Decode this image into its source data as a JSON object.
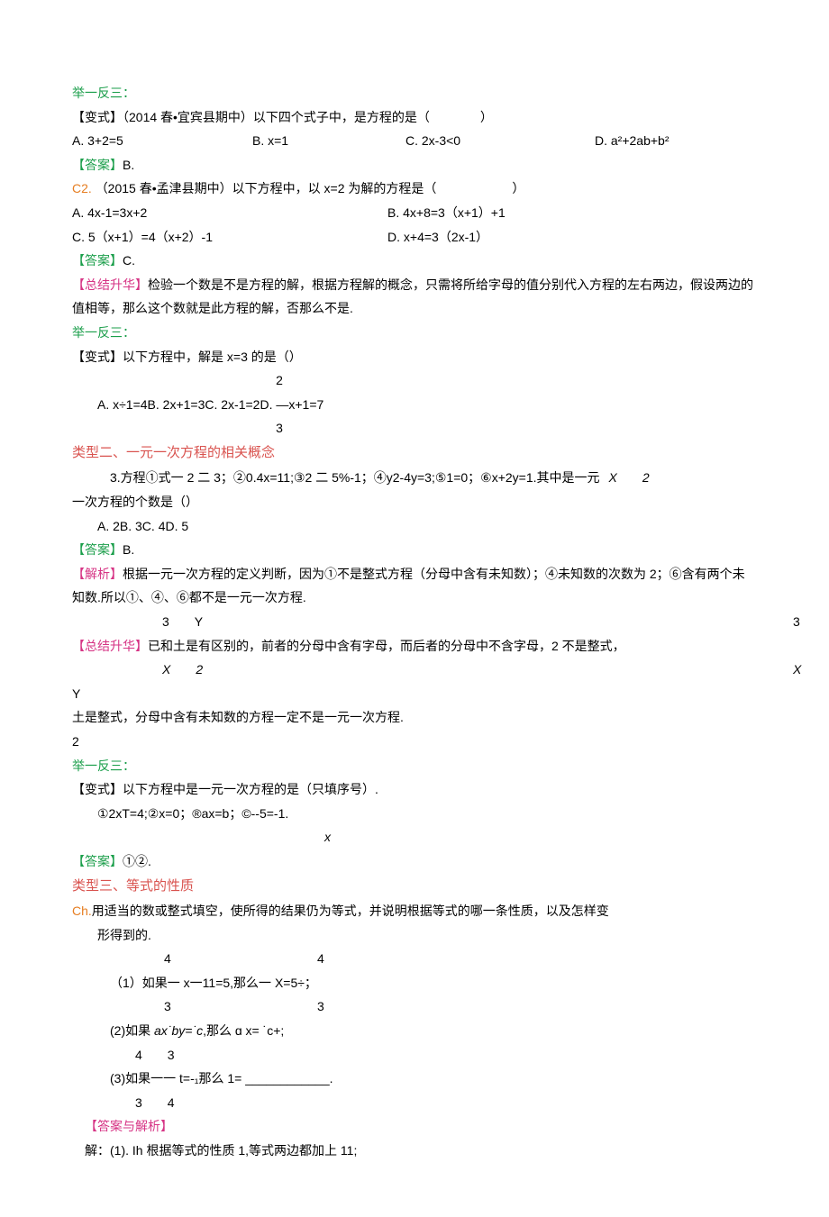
{
  "sec1": {
    "title": "举一反三：",
    "variant": "【变式】（2014 春•宜宾县期中）以下四个式子中，是方程的是（　　　　）",
    "optA": "A. 3+2=5",
    "optB": "B. x=1",
    "optC": "C. 2x-3<0",
    "optD": "D. a²+2ab+b²",
    "ansLabel": "【答案】",
    "ansVal": "B."
  },
  "c2": {
    "q": "C2. （2015 春•孟津县期中）以下方程中，以 x=2 为解的方程是（　　　　　　）",
    "optA": "A. 4x-1=3x+2",
    "optB": "B. 4x+8=3（x+1）+1",
    "optC": "C. 5（x+1）=4（x+2）-1",
    "optD": "D. x+4=3（2x-1）",
    "ansLabel": "【答案】",
    "ansVal": "C.",
    "summaryLabel": "【总结升华】",
    "summary": "检验一个数是不是方程的解，根据方程解的概念，只需将所给字母的值分别代入方程的左右两边，假设两边的值相等，那么这个数就是此方程的解，否那么不是."
  },
  "sec2": {
    "title": "举一反三：",
    "variant": "【变式】以下方程中，解是 x=3 的是（）",
    "line1": "A. x÷1=4B. 2x+1=3C. 2x-1=2D. —x+1=7",
    "frac_top": "2",
    "frac_bot": "3"
  },
  "type2": {
    "title": "类型二、一元一次方程的相关概念",
    "q": "3.方程①式一 2 二 3；②0.4x=11;③2 二 5%-1；④y2-4y=3;⑤1=0；⑥x+2y=1.其中是一元",
    "q_italic": "X　　2",
    "q2": "一次方程的个数是（）",
    "opts": "A. 2B. 3C. 4D. 5",
    "ansLabel": "【答案】",
    "ansVal": "B.",
    "anaLabel": "【解析】",
    "ana": "根据一元一次方程的定义判断，因为①不是整式方程（分母中含有未知数）；④未知数的次数为 2；⑥含有两个未知数.所以①、④、⑥都不是一元一次方程.",
    "row1a": "3　　Y",
    "row1b": "3",
    "sumLabel": "【总结升华】",
    "sum": "已和土是有区别的，前者的分母中含有字母，而后者的分母中不含字母，2 不是整式，",
    "row2a": "X　　2",
    "row2b": "X",
    "y": "Y",
    "tail": "土是整式，分母中含有未知数的方程一定不是一元一次方程.",
    "two": "2"
  },
  "sec3": {
    "title": "举一反三：",
    "variant": "【变式】以下方程中是一元一次方程的是（只填序号）.",
    "opts": "①2xT=4;②x=0；®ax=b；©--5=-1.",
    "x_italic": "x",
    "ansLabel": "【答案】",
    "ansVal": "①②."
  },
  "type3": {
    "title": "类型三、等式的性质",
    "chLabel": "Ch.",
    "q1": "用适当的数或整式填空，使所得的结果仍为等式，并说明根据等式的哪一条性质，以及怎样变",
    "q2": "形得到的.",
    "row1a": "4",
    "row1b": "4",
    "line1": "（1）如果一 x一11=5,那么一 X=5÷；",
    "row2a": "3",
    "row2b": "3",
    "line2_a": "(2)如果 ",
    "line2_b": "ax˙by=˙c",
    "line2_c": ",那么 ɑ x= ˙c+;",
    "row3a": "4　　3",
    "line3": "(3)如果一一 t=-₁那么 1= ____________.",
    "row4a": "3　　4",
    "ansLabel": "【答案与解析】",
    "sol": "解：(1). Ih 根据等式的性质 1,等式两边都加上 11;"
  }
}
